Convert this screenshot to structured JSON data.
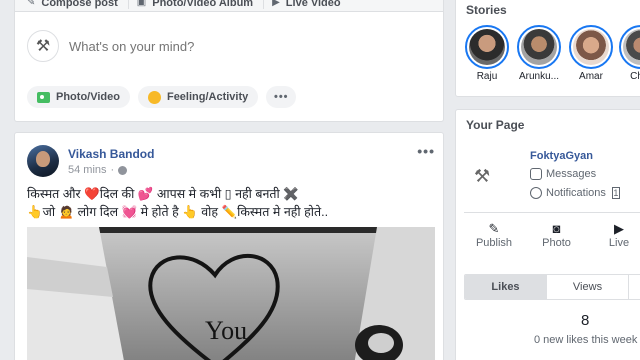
{
  "composer": {
    "tabs": [
      {
        "label": "Compose post",
        "icon": "pencil-icon"
      },
      {
        "label": "Photo/Video Album",
        "icon": "album-icon"
      },
      {
        "label": "Live Video",
        "icon": "video-camera-icon"
      }
    ],
    "placeholder": "What's on your mind?",
    "actions": [
      {
        "label": "Photo/Video",
        "icon": "photo-icon"
      },
      {
        "label": "Feeling/Activity",
        "icon": "smiley-icon"
      }
    ],
    "more_label": "•••"
  },
  "post": {
    "author": "Vikash Bandod",
    "time": "54 mins",
    "menu": "•••",
    "line1": "किस्मत और ❤️दिल की 💕 आपस मे कभी ▯ नही बनती ✖️",
    "line2": "👆जो 🙍 लोग दिल 💓 मे होते है 👆 वोह ✏️किस्मत मे नही होते..",
    "image_text": "You"
  },
  "stories": {
    "title": "Stories",
    "items": [
      {
        "name": "Raju"
      },
      {
        "name": "Arunku..."
      },
      {
        "name": "Amar"
      },
      {
        "name": "Char"
      }
    ]
  },
  "your_page": {
    "title": "Your Page",
    "name": "FoktyaGyan",
    "messages_label": "Messages",
    "notifications_label": "Notifications",
    "notifications_count": "1",
    "actions": [
      {
        "label": "Publish",
        "icon": "pencil-square-icon"
      },
      {
        "label": "Photo",
        "icon": "camera-icon"
      },
      {
        "label": "Live",
        "icon": "video-icon"
      }
    ],
    "tabs": [
      {
        "label": "Likes",
        "active": true
      },
      {
        "label": "Views",
        "active": false
      }
    ],
    "likes_count": "8",
    "likes_desc": "0 new likes this week"
  },
  "colors": {
    "link_blue": "#365899",
    "story_ring": "#1877f2",
    "background": "#e9ebee"
  }
}
